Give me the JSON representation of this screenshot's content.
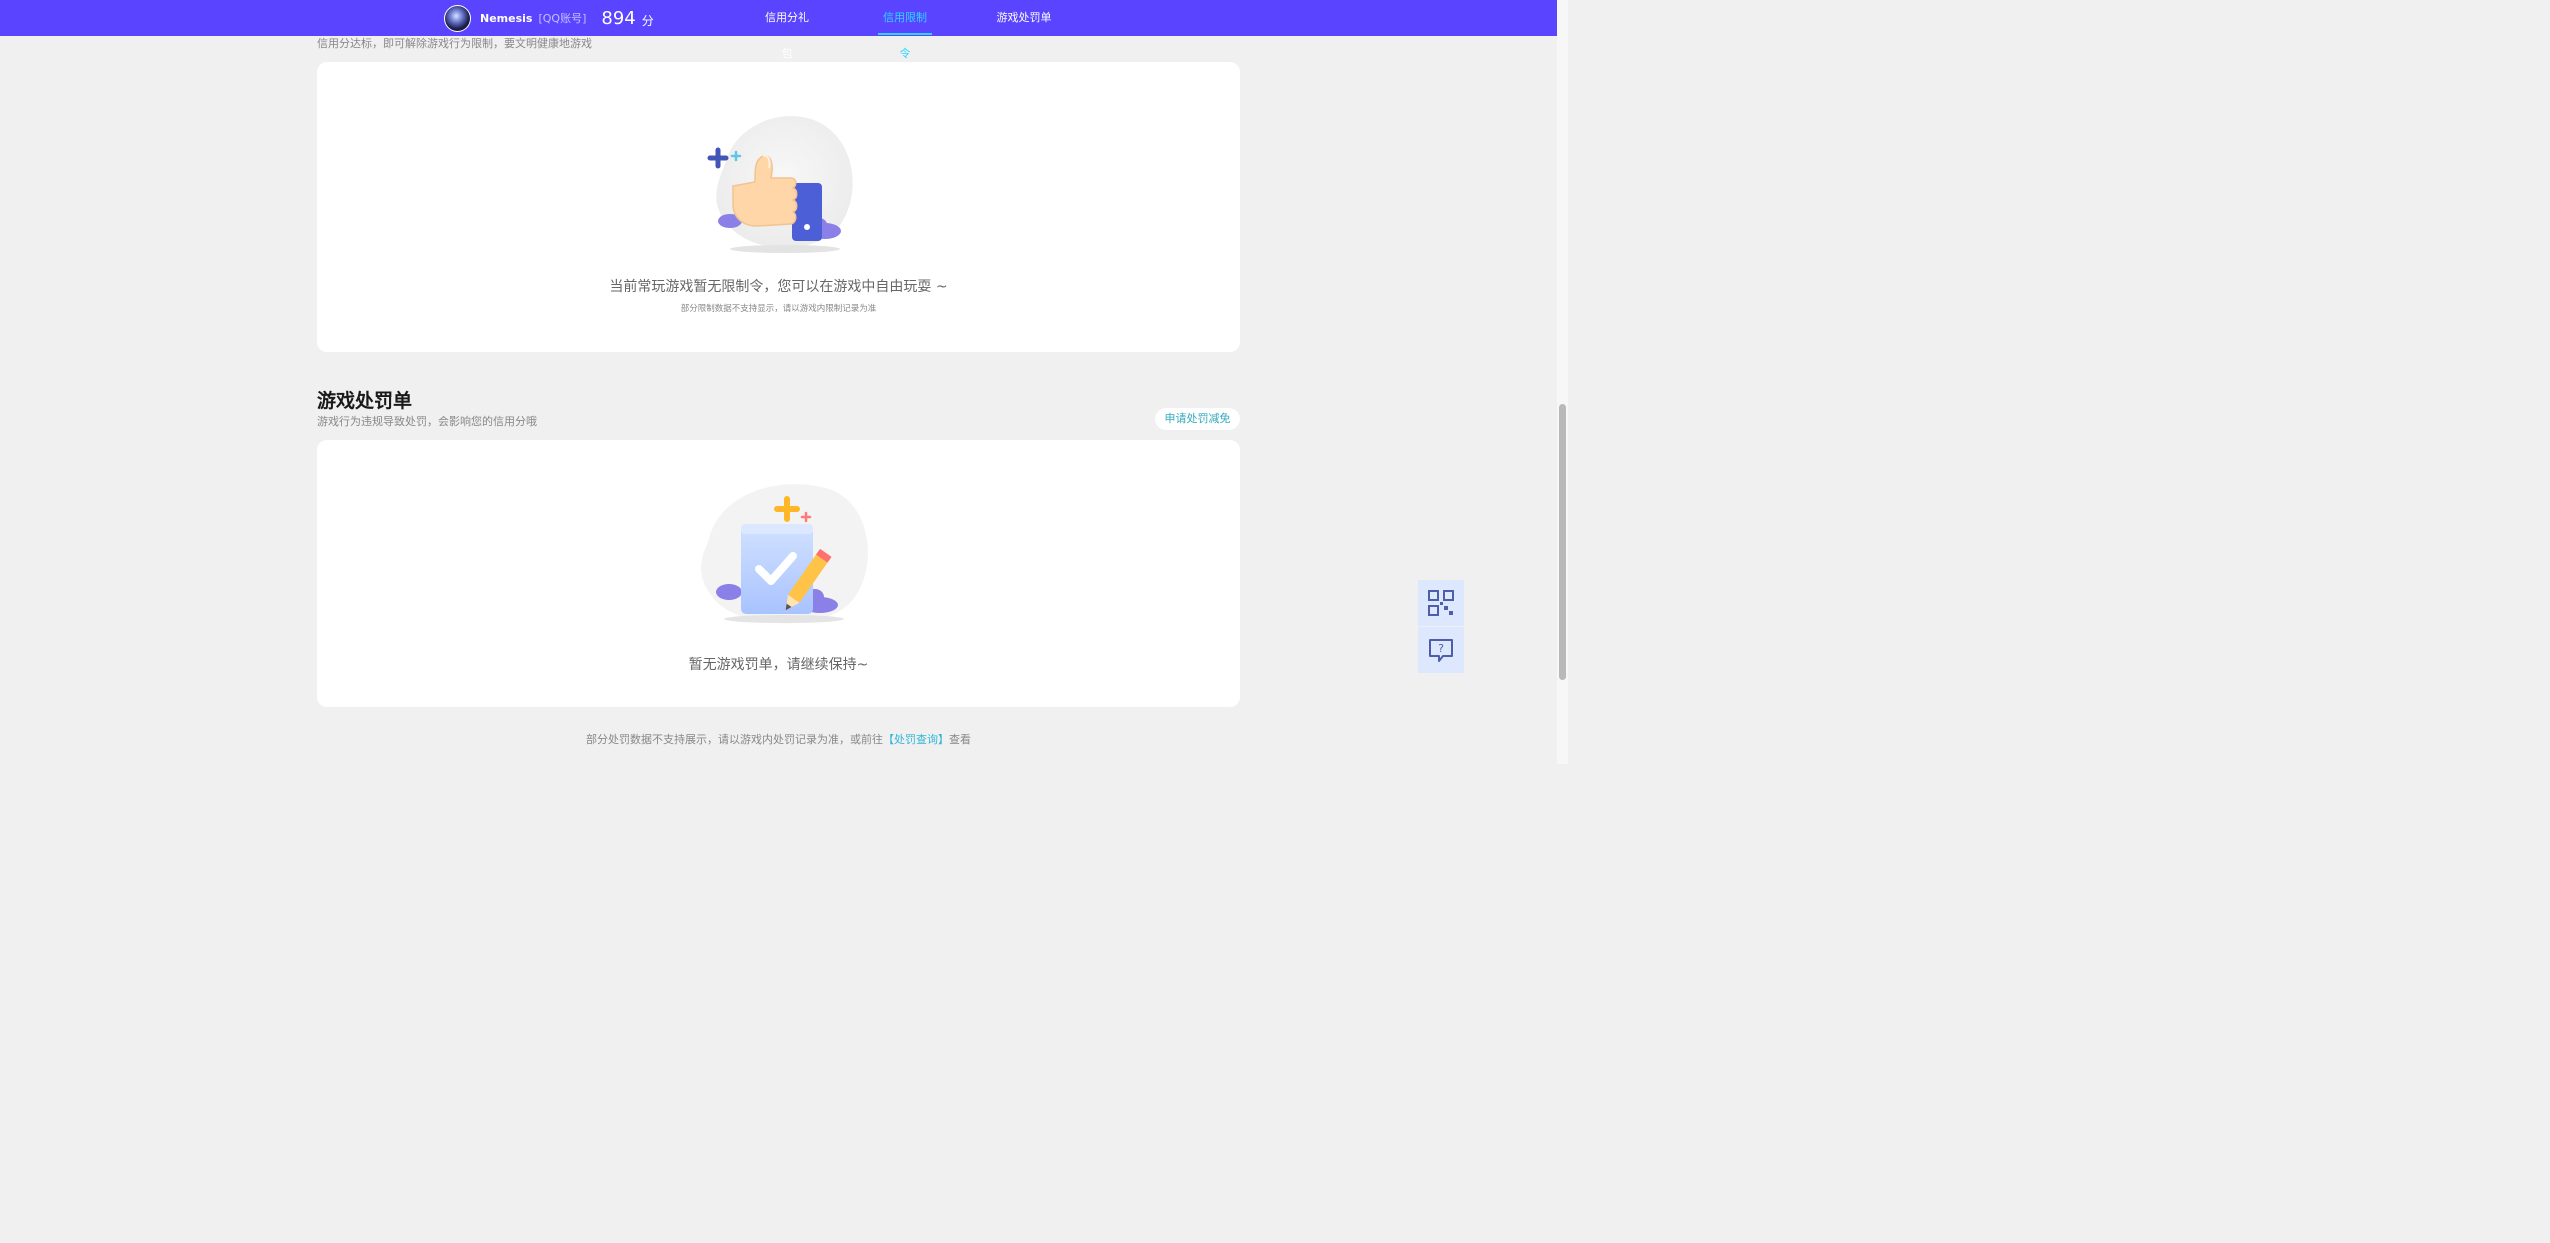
{
  "header": {
    "username": "Nemesis",
    "account_type": "[QQ账号]",
    "score": "894",
    "score_unit": "分",
    "tabs": [
      {
        "label": "信用分礼包",
        "active": false
      },
      {
        "label": "信用限制令",
        "active": true
      },
      {
        "label": "游戏处罚单",
        "active": false
      }
    ],
    "accent_color": "#5a44ff",
    "active_tab_color": "#2ed6ff"
  },
  "restriction_section": {
    "subtitle": "信用分达标，即可解除游戏行为限制，要文明健康地游戏",
    "empty_message": "当前常玩游戏暂无限制令，您可以在游戏中自由玩耍 ~",
    "empty_note": "部分限制数据不支持显示，请以游戏内限制记录为准",
    "illustration": "thumbs-up-illustration"
  },
  "punishment_section": {
    "title": "游戏处罚单",
    "subtitle": "游戏行为违规导致处罚，会影响您的信用分哦",
    "appeal_button": "申请处罚减免",
    "empty_message": "暂无游戏罚单，请继续保持~",
    "illustration": "clipboard-pencil-illustration"
  },
  "footer": {
    "note_prefix": "部分处罚数据不支持展示，请以游戏内处罚记录为准，或前往",
    "link_text": "【处罚查询】",
    "note_suffix": "查看"
  },
  "floating": {
    "qr_icon": "qr-code-icon",
    "help_icon": "help-chat-icon"
  }
}
